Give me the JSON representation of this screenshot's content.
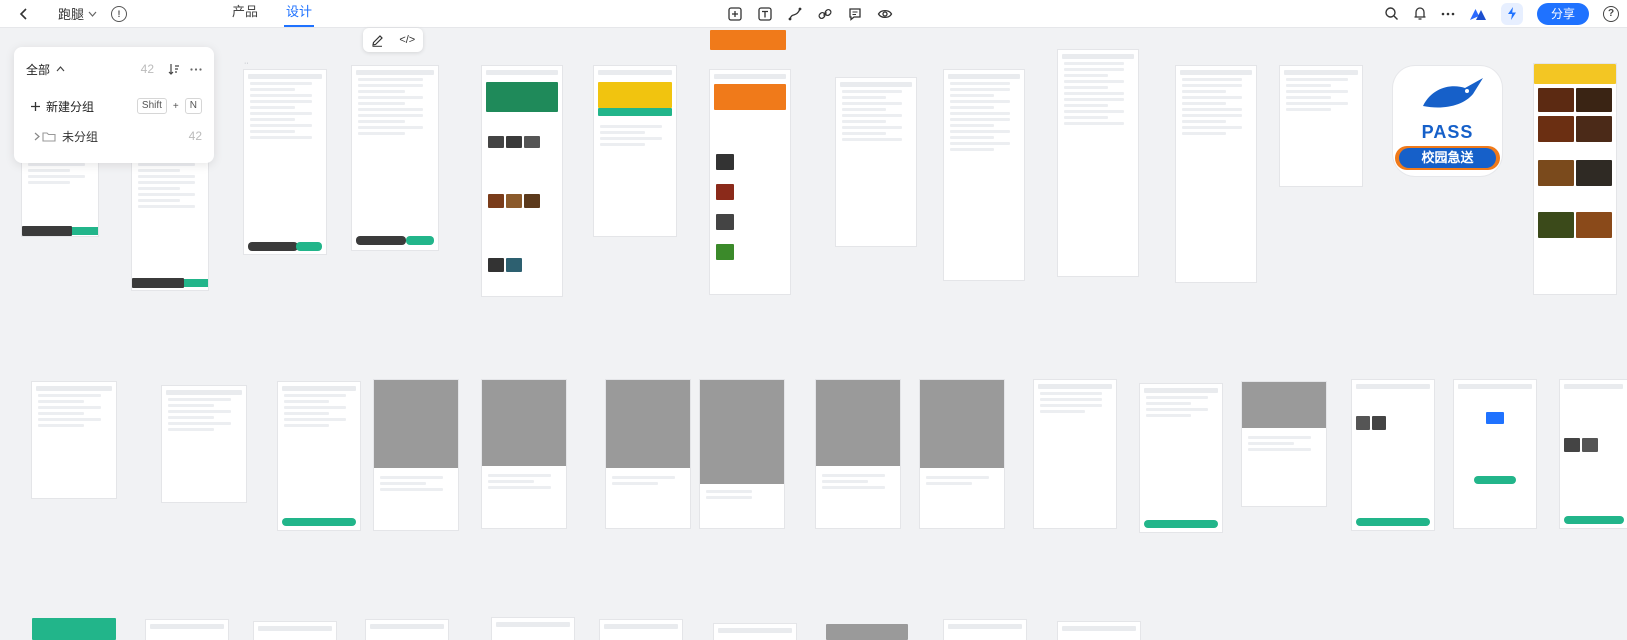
{
  "topbar": {
    "project_name": "跑腿",
    "tabs": [
      {
        "label": "产品",
        "active": false
      },
      {
        "label": "设计",
        "active": true
      }
    ],
    "share_label": "分享"
  },
  "float_toolbar": {
    "code_label": "</>"
  },
  "panel": {
    "title": "全部",
    "count": "42",
    "new_group_label": "新建分组",
    "shortcut_key1": "Shift",
    "shortcut_plus": "+",
    "shortcut_key2": "N",
    "ungrouped_label": "未分组",
    "ungrouped_count": "42"
  },
  "logo": {
    "brand_text": "PASS",
    "subtitle": "校园急送"
  },
  "colors": {
    "accent": "#1f72ff",
    "green": "#22b58a",
    "orange": "#f07a1a",
    "brand_blue": "#1660c9"
  },
  "icons": [
    "back-icon",
    "chevron-down-icon",
    "info-icon",
    "frame-icon",
    "text-icon",
    "pen-icon",
    "link-icon",
    "comment-icon",
    "eye-icon",
    "search-icon",
    "bell-icon",
    "more-icon",
    "logo-icon",
    "bolt-icon",
    "help-icon",
    "edit-icon",
    "code-icon",
    "sort-icon",
    "plus-icon",
    "folder-icon"
  ]
}
